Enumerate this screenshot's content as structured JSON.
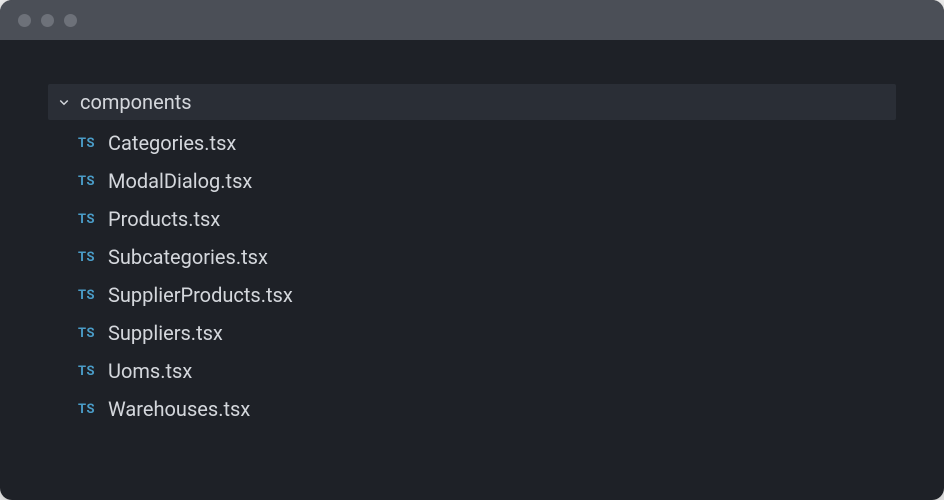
{
  "explorer": {
    "folder": {
      "name": "components",
      "expanded": true
    },
    "files": [
      {
        "icon": "TS",
        "name": "Categories.tsx"
      },
      {
        "icon": "TS",
        "name": "ModalDialog.tsx"
      },
      {
        "icon": "TS",
        "name": "Products.tsx"
      },
      {
        "icon": "TS",
        "name": "Subcategories.tsx"
      },
      {
        "icon": "TS",
        "name": "SupplierProducts.tsx"
      },
      {
        "icon": "TS",
        "name": "Suppliers.tsx"
      },
      {
        "icon": "TS",
        "name": "Uoms.tsx"
      },
      {
        "icon": "TS",
        "name": "Warehouses.tsx"
      }
    ]
  }
}
